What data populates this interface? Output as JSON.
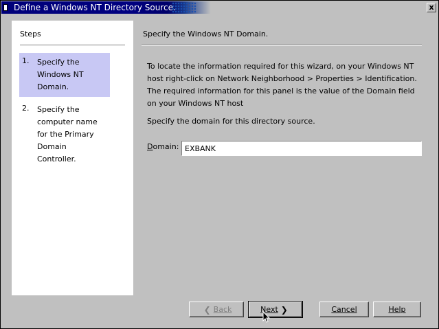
{
  "window": {
    "title": "Define a Windows NT Directory Source.",
    "close_label": "x"
  },
  "steps": {
    "title": "Steps",
    "items": [
      {
        "num": "1.",
        "label": "Specify the Windows NT Domain."
      },
      {
        "num": "2.",
        "label": "Specify the computer name for the Primary Domain Controller."
      }
    ]
  },
  "panel": {
    "header": "Specify the Windows NT Domain.",
    "description": "To locate the information required for this wizard, on your Windows NT host right-click on Network Neighborhood > Properties > Identification. The required information for this panel is the value of the Domain field on your Windows NT host",
    "prompt": "Specify the domain for this directory source.",
    "domain_label_mnemonic": "D",
    "domain_label_rest": "omain:",
    "domain_value": "EXBANK"
  },
  "buttons": {
    "back": "Back",
    "next": "Next",
    "cancel": "Cancel",
    "help": "Help"
  },
  "colors": {
    "title_bar": "#000080",
    "selected_step": "#c8c8f4",
    "dialog_bg": "#c0c0c0"
  }
}
